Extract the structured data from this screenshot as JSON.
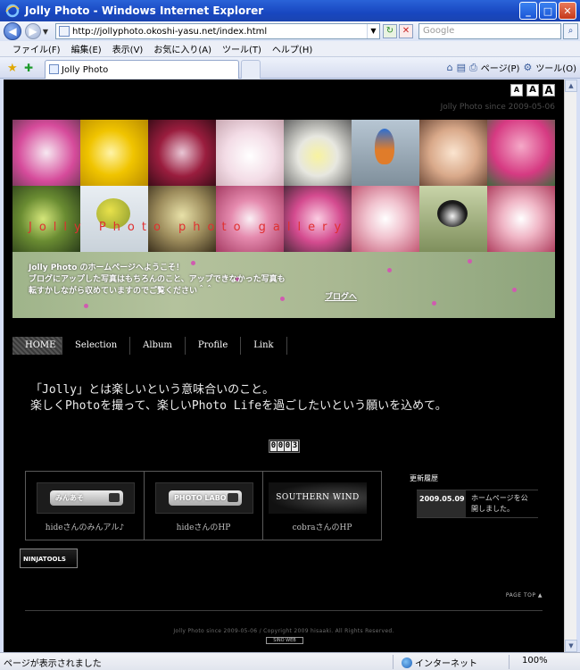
{
  "window": {
    "title": "Jolly Photo - Windows Internet Explorer",
    "minimize": "_",
    "maximize": "□",
    "close": "✕"
  },
  "address": {
    "back_icon": "◀",
    "forward_icon": "▶",
    "dropdown": "▼",
    "url": "http://jollyphoto.okoshi-yasu.net/index.html",
    "refresh_icon": "↻",
    "stop_icon": "✕",
    "search_placeholder": "Google",
    "search_icon": "⌕"
  },
  "menu": [
    "ファイル(F)",
    "編集(E)",
    "表示(V)",
    "お気に入り(A)",
    "ツール(T)",
    "ヘルプ(H)"
  ],
  "tabs": {
    "active_title": "Jolly Photo",
    "commands": {
      "home": "⌂",
      "feeds": "▤",
      "print": "⎙",
      "page": "ページ(P)",
      "tools": "ツール(O)"
    }
  },
  "page": {
    "text_size_buttons": [
      "A",
      "A",
      "A"
    ],
    "since_top": "Jolly Photo since 2009-05-06",
    "banner": {
      "title": "Jolly Photo photo gallery",
      "welcome_lines": [
        "Jolly Photo のホームページへようこそ！",
        "ブログにアップした写真はもちろんのこと、アップできなかった写真も",
        "転すかしながら収めていますのでご覧ください＾＾"
      ],
      "blog_link": "ブログへ"
    },
    "nav": [
      "HOME",
      "Selection",
      "Album",
      "Profile",
      "Link"
    ],
    "intro_lines": [
      "「Jolly」とは楽しいという意味合いのこと。",
      "楽しくPhotoを撮って、楽しいPhoto Lifeを過ごしたいという願いを込めて。"
    ],
    "counter": [
      "0",
      "0",
      "0",
      "3"
    ],
    "links": [
      {
        "thumb_text": "みんあそ",
        "caption": "hideさんのみんアル♪"
      },
      {
        "thumb_text": "PHOTO LABO",
        "caption": "hideさんのHP"
      },
      {
        "thumb_text": "SOUTHERN WIND",
        "caption": "cobraさんのHP"
      }
    ],
    "updates": {
      "title": "更新履歴",
      "entries": [
        {
          "date": "2009.05.09",
          "message": "ホームページを公開しました。"
        }
      ]
    },
    "ninja": "NINJATOOLS",
    "page_top": "PAGE TOP ▲",
    "copyright": "Jolly Photo since 2009-05-06 / Copyright 2009 hisaaki. All Rights Reserved.",
    "badge": "SINO WEB"
  },
  "status": {
    "left": "ページが表示されました",
    "zone": "インターネット",
    "zoom": "100%"
  }
}
